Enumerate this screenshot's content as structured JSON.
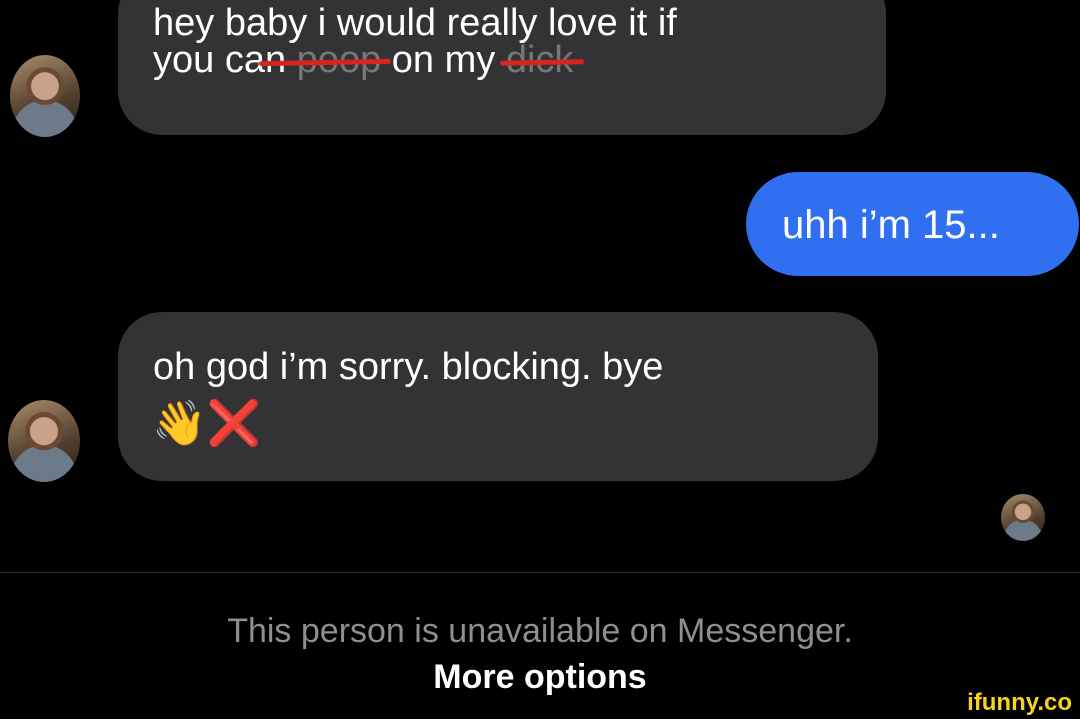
{
  "messages": [
    {
      "sender": "them",
      "line1": "hey baby i would really love it if",
      "line2_parts": [
        "you ca",
        "n ",
        "poop",
        " on my",
        "dick"
      ]
    },
    {
      "sender": "me",
      "text": "uhh i’m 15..."
    },
    {
      "sender": "them",
      "line1": "oh god i’m sorry. blocking. bye",
      "emoji": [
        "👋",
        "❌"
      ]
    }
  ],
  "footer": {
    "notice": "This person is unavailable on Messenger.",
    "more_options": "More options"
  },
  "watermark": "ifunny.co",
  "colors": {
    "background": "#000000",
    "incoming_bubble": "#333335",
    "outgoing_bubble": "#2f6ff0",
    "strike": "#d8231e"
  }
}
